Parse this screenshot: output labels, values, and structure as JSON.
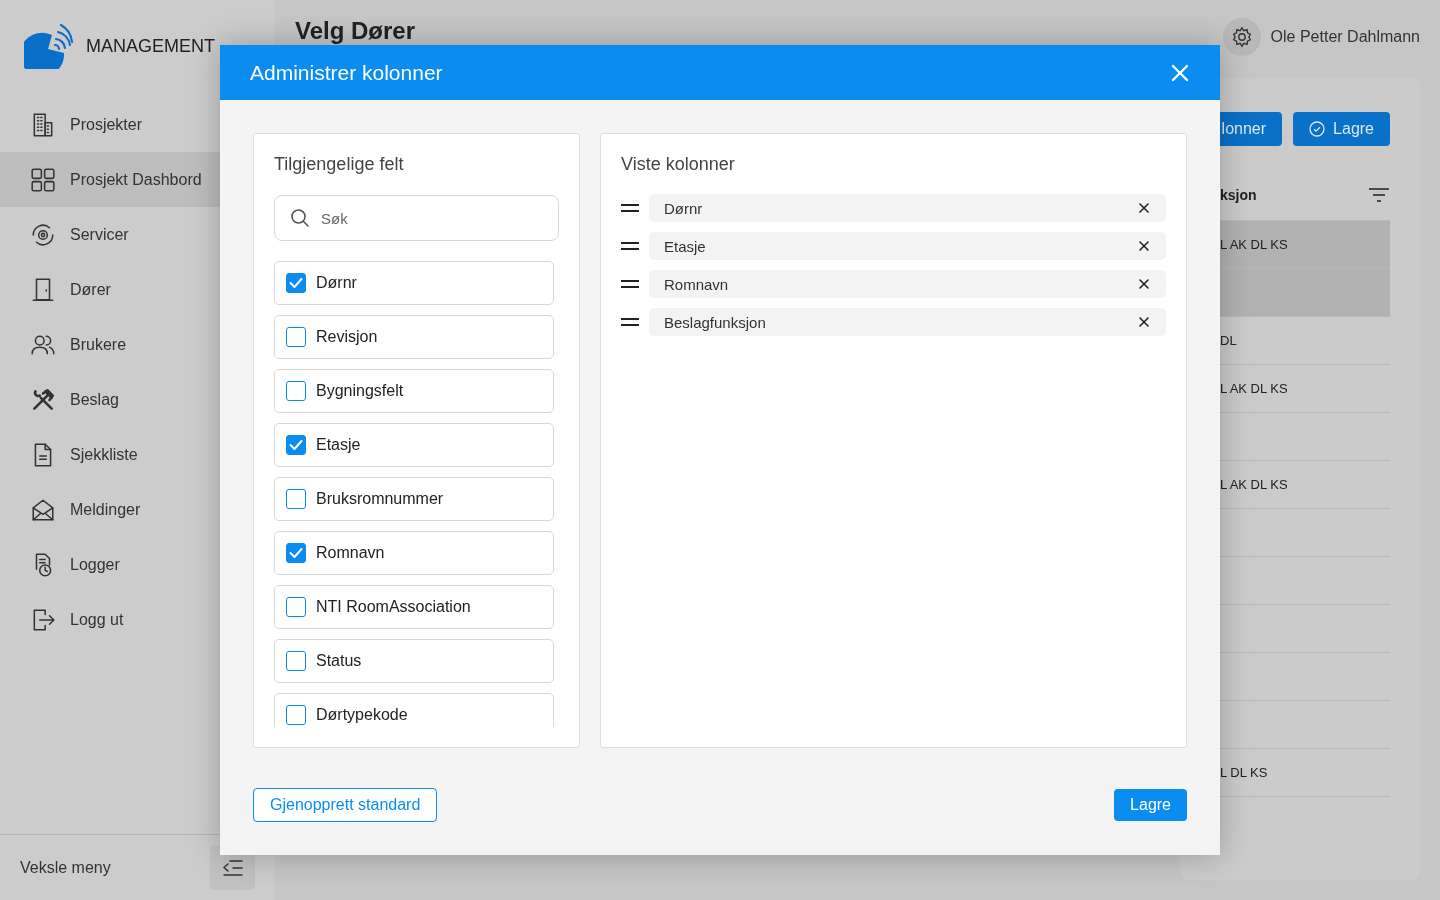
{
  "sidebar": {
    "logo_text": "MANAGEMENT",
    "items": [
      {
        "label": "Prosjekter",
        "selected": false
      },
      {
        "label": "Prosjekt Dashbord",
        "selected": true
      },
      {
        "label": "Servicer",
        "selected": false
      },
      {
        "label": "Dører",
        "selected": false
      },
      {
        "label": "Brukere",
        "selected": false
      },
      {
        "label": "Beslag",
        "selected": false
      },
      {
        "label": "Sjekkliste",
        "selected": false
      },
      {
        "label": "Meldinger",
        "selected": false
      },
      {
        "label": "Logger",
        "selected": false
      },
      {
        "label": "Logg ut",
        "selected": false
      }
    ],
    "toggle_label": "Veksle meny"
  },
  "header": {
    "title": "Velg Dører",
    "user": "Ole Petter Dahlmann"
  },
  "background_table": {
    "columns_button": "lonner",
    "save_button": "Lagre",
    "column_header": "ksjon",
    "rows": [
      {
        "selected": true,
        "cell": "L AK DL KS"
      },
      {
        "selected": true
      },
      {
        "selected": false,
        "cell": "DL"
      },
      {
        "selected": false,
        "cell": "L AK DL KS"
      },
      {
        "selected": false
      },
      {
        "selected": false,
        "cell": "L AK DL KS"
      },
      {
        "selected": false
      },
      {
        "selected": false
      },
      {
        "selected": false
      },
      {
        "selected": false
      },
      {
        "selected": false
      },
      {
        "selected": false,
        "cell": "L DL KS"
      }
    ]
  },
  "dialog": {
    "title": "Administrer kolonner",
    "available": {
      "title": "Tilgjengelige felt",
      "search_placeholder": "Søk",
      "fields": [
        {
          "label": "Dørnr",
          "checked": true
        },
        {
          "label": "Revisjon",
          "checked": false
        },
        {
          "label": "Bygningsfelt",
          "checked": false
        },
        {
          "label": "Etasje",
          "checked": true
        },
        {
          "label": "Bruksromnummer",
          "checked": false
        },
        {
          "label": "Romnavn",
          "checked": true
        },
        {
          "label": "NTI RoomAssociation",
          "checked": false
        },
        {
          "label": "Status",
          "checked": false
        },
        {
          "label": "Dørtypekode",
          "checked": false
        }
      ]
    },
    "shown": {
      "title": "Viste kolonner",
      "columns": [
        "Dørnr",
        "Etasje",
        "Romnavn",
        "Beslagfunksjon"
      ]
    },
    "reset_button": "Gjenopprett standard",
    "save_button": "Lagre"
  }
}
